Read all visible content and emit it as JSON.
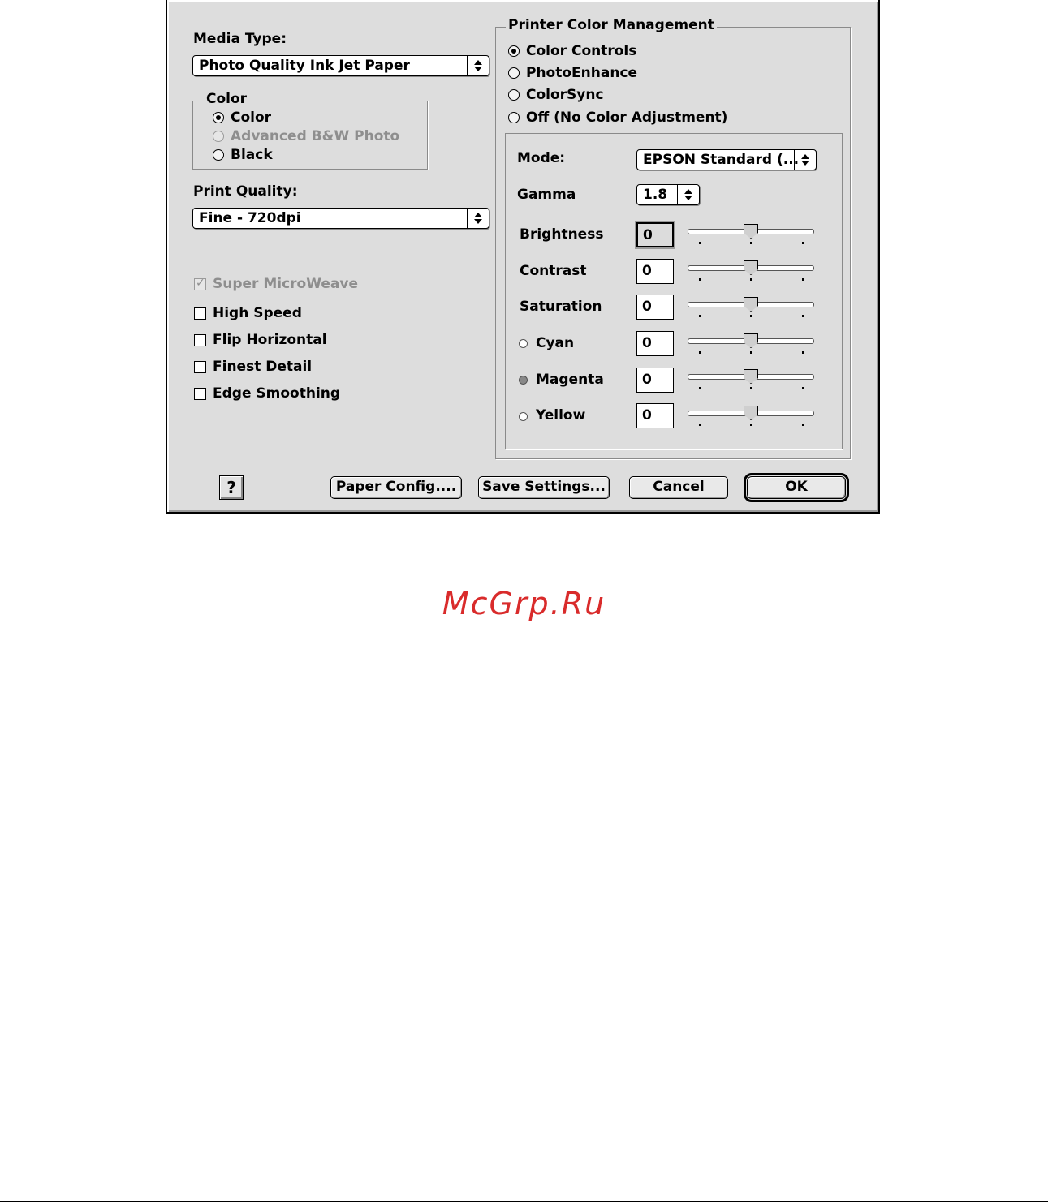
{
  "media_type": {
    "label": "Media Type:",
    "selected": "Photo Quality Ink Jet Paper"
  },
  "color_group": {
    "title": "Color",
    "options": [
      {
        "label": "Color",
        "selected": true,
        "enabled": true
      },
      {
        "label": "Advanced B&W Photo",
        "selected": false,
        "enabled": false
      },
      {
        "label": "Black",
        "selected": false,
        "enabled": true
      }
    ]
  },
  "print_quality": {
    "label": "Print Quality:",
    "selected": "Fine - 720dpi"
  },
  "checkboxes": [
    {
      "label": "Super MicroWeave",
      "checked": true,
      "enabled": false
    },
    {
      "label": "High Speed",
      "checked": false,
      "enabled": true
    },
    {
      "label": "Flip Horizontal",
      "checked": false,
      "enabled": true
    },
    {
      "label": "Finest Detail",
      "checked": false,
      "enabled": true
    },
    {
      "label": "Edge Smoothing",
      "checked": false,
      "enabled": true
    }
  ],
  "color_management": {
    "title": "Printer Color Management",
    "options": [
      {
        "label": "Color Controls",
        "selected": true
      },
      {
        "label": "PhotoEnhance",
        "selected": false
      },
      {
        "label": "ColorSync",
        "selected": false
      },
      {
        "label": "Off (No Color Adjustment)",
        "selected": false
      }
    ],
    "mode": {
      "label": "Mode:",
      "selected": "EPSON Standard (..."
    },
    "gamma": {
      "label": "Gamma",
      "selected": "1.8"
    },
    "sliders": [
      {
        "label": "Brightness",
        "value": "0",
        "level": 0.5
      },
      {
        "label": "Contrast",
        "value": "0",
        "level": 0.5
      },
      {
        "label": "Saturation",
        "value": "0",
        "level": 0.5
      },
      {
        "label": "Cyan",
        "value": "0",
        "level": 0.5
      },
      {
        "label": "Magenta",
        "value": "0",
        "level": 0.5
      },
      {
        "label": "Yellow",
        "value": "0",
        "level": 0.5
      }
    ]
  },
  "buttons": {
    "help": "?",
    "paper_config": "Paper Config....",
    "save_settings": "Save Settings...",
    "cancel": "Cancel",
    "ok": "OK"
  },
  "watermark": "McGrp.Ru"
}
